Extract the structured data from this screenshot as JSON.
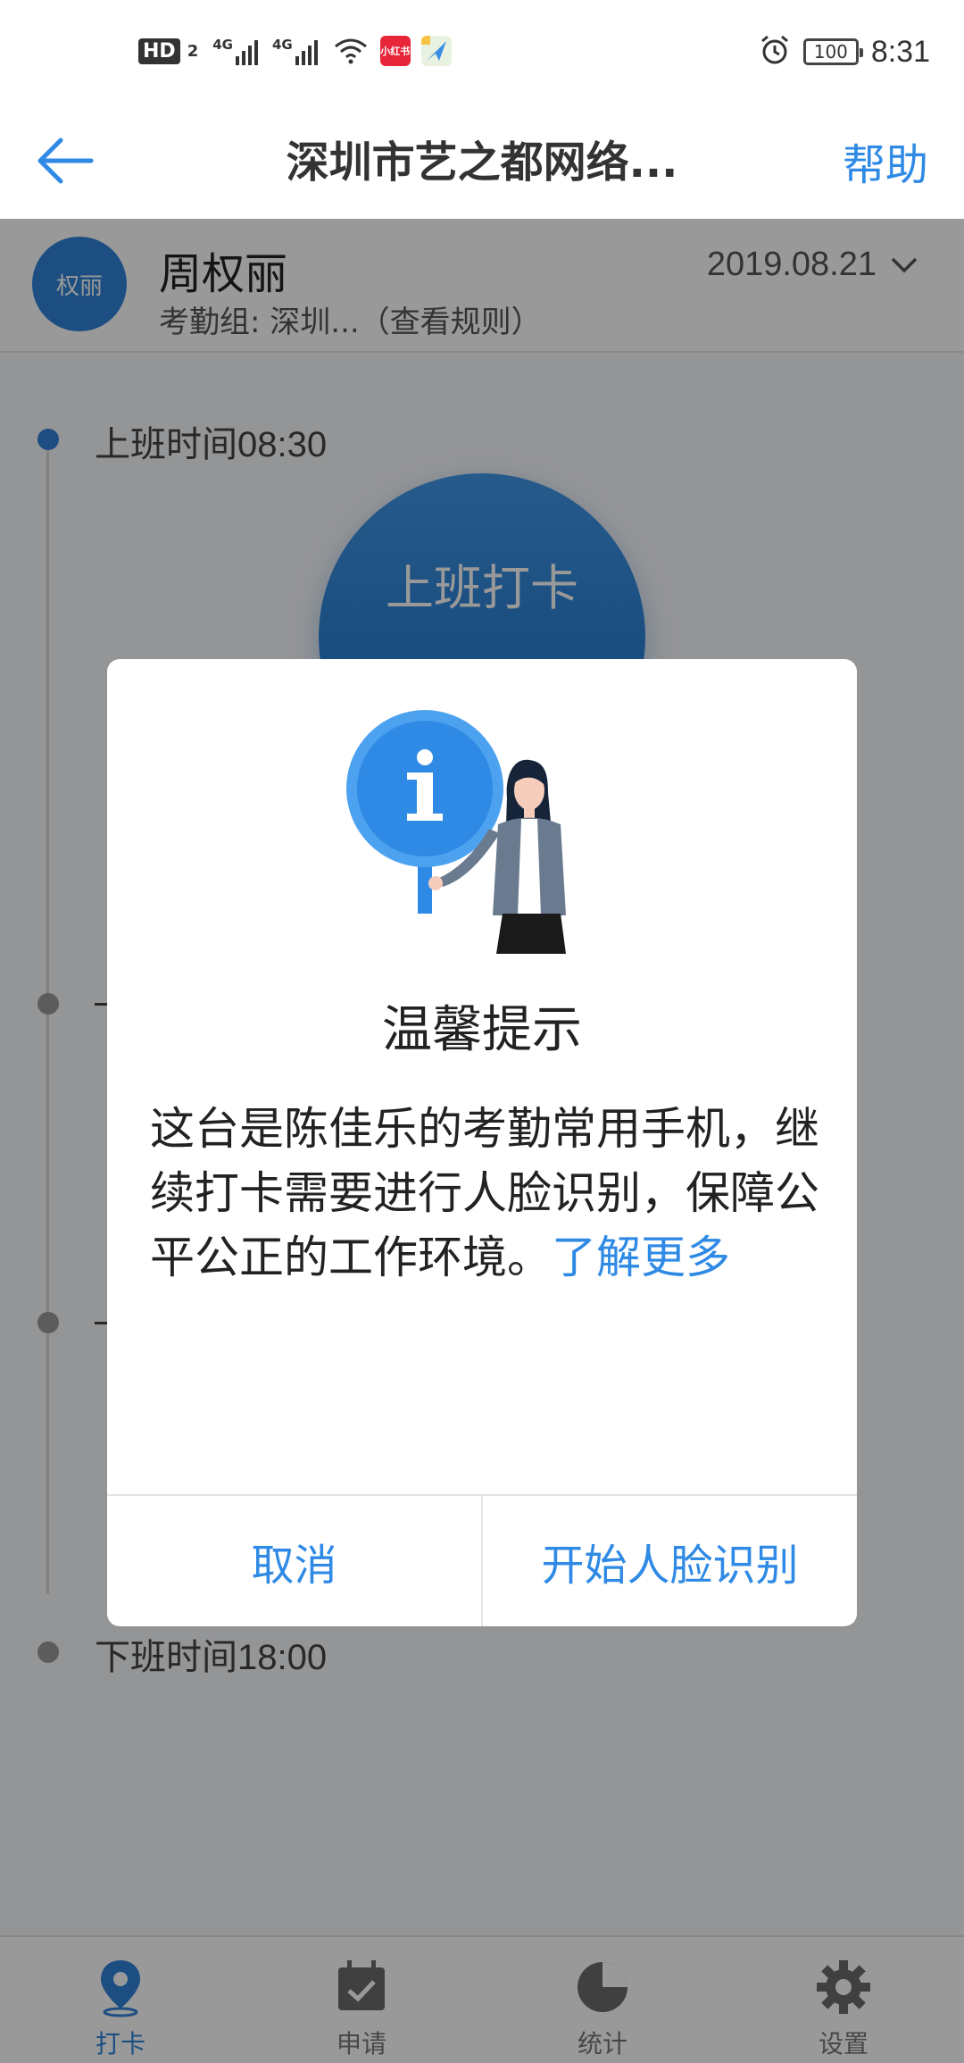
{
  "status_bar": {
    "hd_label": "HD",
    "hd_sub": "2",
    "network_1": "4G",
    "network_2": "4G",
    "app_badge": "小红书",
    "battery": "100",
    "time": "8:31"
  },
  "nav": {
    "title": "深圳市艺之都网络...",
    "help_label": "帮助"
  },
  "profile": {
    "avatar_text": "权丽",
    "name": "周权丽",
    "group_text": "考勤组: 深圳...（查看规则）",
    "date": "2019.08.21"
  },
  "timeline": {
    "start_label": "上班时间08:30",
    "end_label": "下班时间18:00",
    "clock_in_label": "上班打卡"
  },
  "dialog": {
    "title": "温馨提示",
    "message": "这台是陈佳乐的考勤常用手机，继续打卡需要进行人脸识别，保障公平公正的工作环境。",
    "link": "了解更多",
    "cancel_label": "取消",
    "confirm_label": "开始人脸识别"
  },
  "tabs": [
    {
      "label": "打卡",
      "icon": "location-pin-icon",
      "active": true
    },
    {
      "label": "申请",
      "icon": "calendar-check-icon",
      "active": false
    },
    {
      "label": "统计",
      "icon": "pie-chart-icon",
      "active": false
    },
    {
      "label": "设置",
      "icon": "gear-icon",
      "active": false
    }
  ],
  "colors": {
    "accent": "#2f8ae5",
    "primary_button": "#2f82d9",
    "overlay": "rgba(0,0,0,0.40)"
  }
}
